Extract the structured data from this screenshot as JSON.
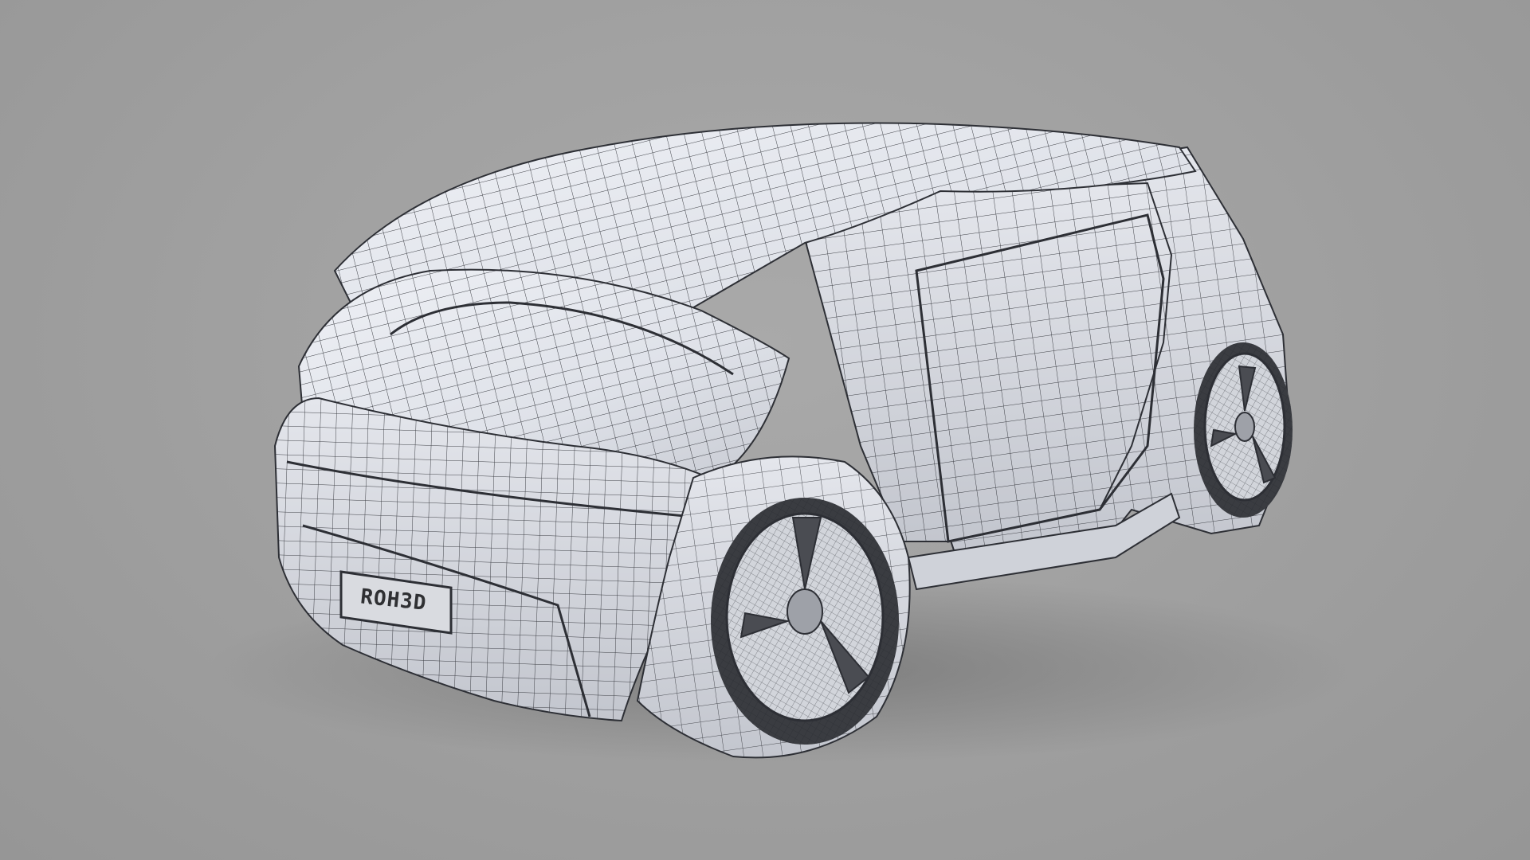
{
  "scene": {
    "subject": "wireframe-car-model",
    "license_plate_text": "ROH3D",
    "colors": {
      "background": "#a1a1a1",
      "body": "#e6e8ee",
      "body_shadow": "#c6c9d1",
      "wire": "#2d2f35",
      "tire": "#3a3c41",
      "plate": "#d9dbe0"
    }
  }
}
